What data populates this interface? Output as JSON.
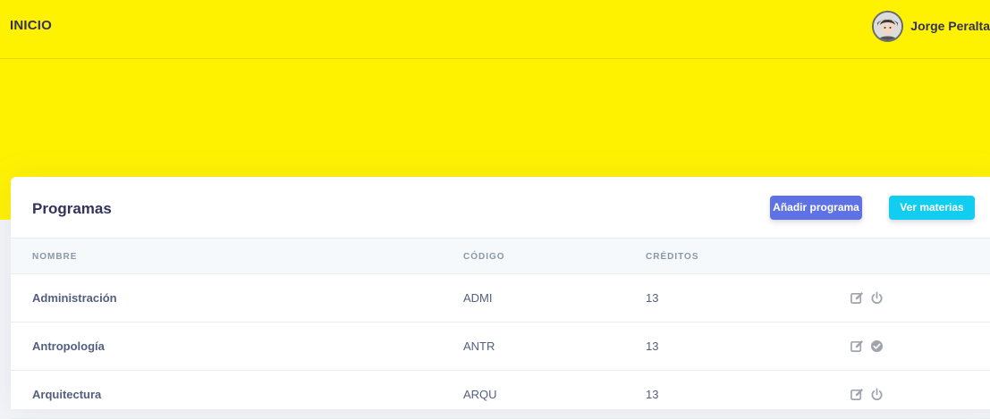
{
  "header": {
    "brand": "INICIO",
    "user_name": "Jorge Peralta"
  },
  "card": {
    "title": "Programas",
    "add_button": "Añadir programa",
    "view_button": "Ver materias"
  },
  "table": {
    "columns": [
      "NOMBRE",
      "CÓDIGO",
      "CRÉDITOS"
    ],
    "rows": [
      {
        "nombre": "Administración",
        "codigo": "ADMI",
        "creditos": "13",
        "status_icon": "power-icon"
      },
      {
        "nombre": "Antropología",
        "codigo": "ANTR",
        "creditos": "13",
        "status_icon": "check-circle-icon"
      },
      {
        "nombre": "Arquitectura",
        "codigo": "ARQU",
        "creditos": "13",
        "status_icon": "power-icon"
      }
    ]
  },
  "colors": {
    "accent_yellow": "#fff200",
    "primary": "#5e72e4",
    "info": "#11cdef",
    "icon_gray": "#a0a4ad"
  }
}
